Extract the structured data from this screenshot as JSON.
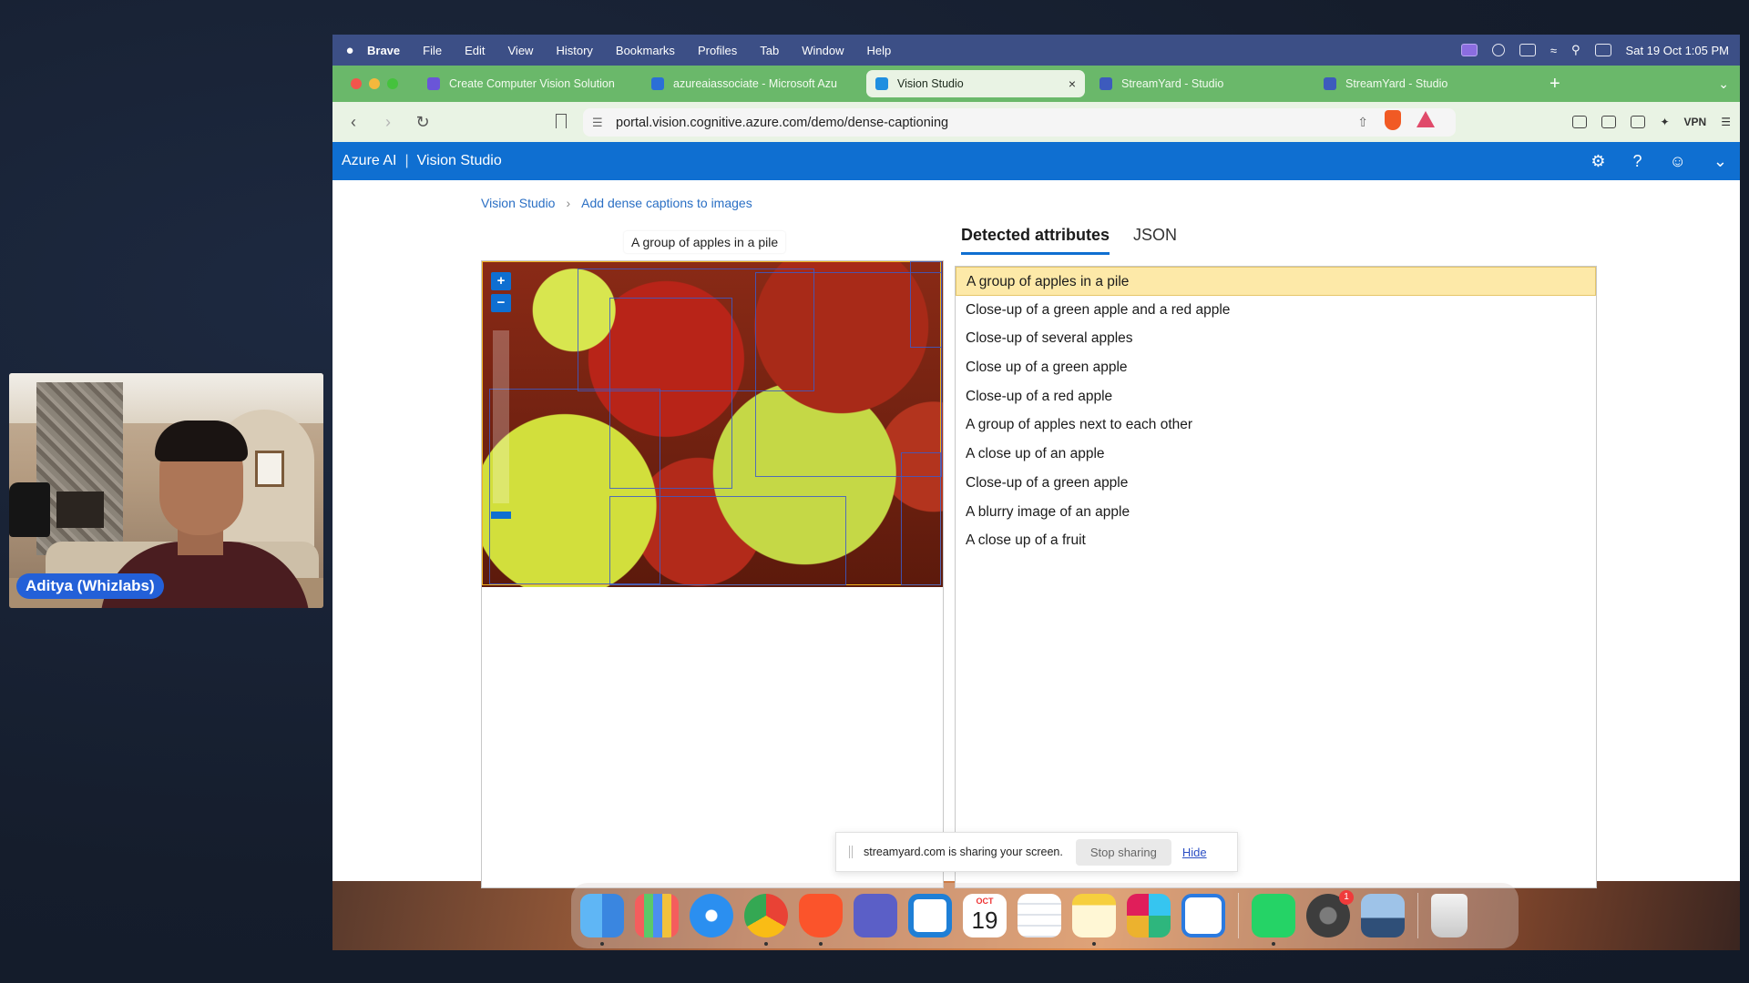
{
  "webcam": {
    "name": "Aditya (Whizlabs)"
  },
  "menubar": {
    "apple": "",
    "items": [
      "Brave",
      "File",
      "Edit",
      "View",
      "History",
      "Bookmarks",
      "Profiles",
      "Tab",
      "Window",
      "Help"
    ],
    "clock": "Sat 19 Oct  1:05 PM"
  },
  "tabs": [
    {
      "title": "Create Computer Vision Solution",
      "color": "#6a55d8"
    },
    {
      "title": "azureaiassociate - Microsoft Azu",
      "color": "#2b6fd6"
    },
    {
      "title": "Vision Studio",
      "color": "#1f8fe0",
      "close": "×"
    },
    {
      "title": "StreamYard - Studio",
      "color": "#3d5bbd"
    },
    {
      "title": "StreamYard - Studio",
      "color": "#3d5bbd"
    }
  ],
  "toolbar": {
    "url": "portal.vision.cognitive.azure.com/demo/dense-captioning",
    "vpn": "VPN"
  },
  "header": {
    "brand": "Azure AI",
    "separator": "|",
    "product": "Vision Studio"
  },
  "breadcrumb": {
    "root": "Vision Studio",
    "current": "Add dense captions to images"
  },
  "image": {
    "tooltip": "A group of apples in a pile",
    "zoom_in": "+",
    "zoom_out": "−"
  },
  "results": {
    "tab_detected": "Detected attributes",
    "tab_json": "JSON",
    "captions": [
      "A group of apples in a pile",
      "Close-up of a green apple and a red apple",
      "Close-up of several apples",
      "Close up of a green apple",
      "Close-up of a red apple",
      "A group of apples next to each other",
      "A close up of an apple",
      "Close-up of a green apple",
      "A blurry image of an apple",
      "A close up of a fruit"
    ],
    "selected_index": 0
  },
  "share_bar": {
    "message": "streamyard.com is sharing your screen.",
    "stop": "Stop sharing",
    "hide": "Hide"
  },
  "dock": {
    "calendar_month": "OCT",
    "calendar_day": "19",
    "settings_badge": "1",
    "apps": [
      "finder-icon",
      "launchpad-icon",
      "safari-icon",
      "chrome-icon",
      "brave-icon",
      "teams-icon",
      "vscode-icon",
      "calendar-icon",
      "reminders-icon",
      "notes-icon",
      "slack-icon",
      "tasks-icon",
      "whatsapp-icon",
      "system-settings-icon",
      "preview-icon",
      "trash-icon"
    ]
  }
}
